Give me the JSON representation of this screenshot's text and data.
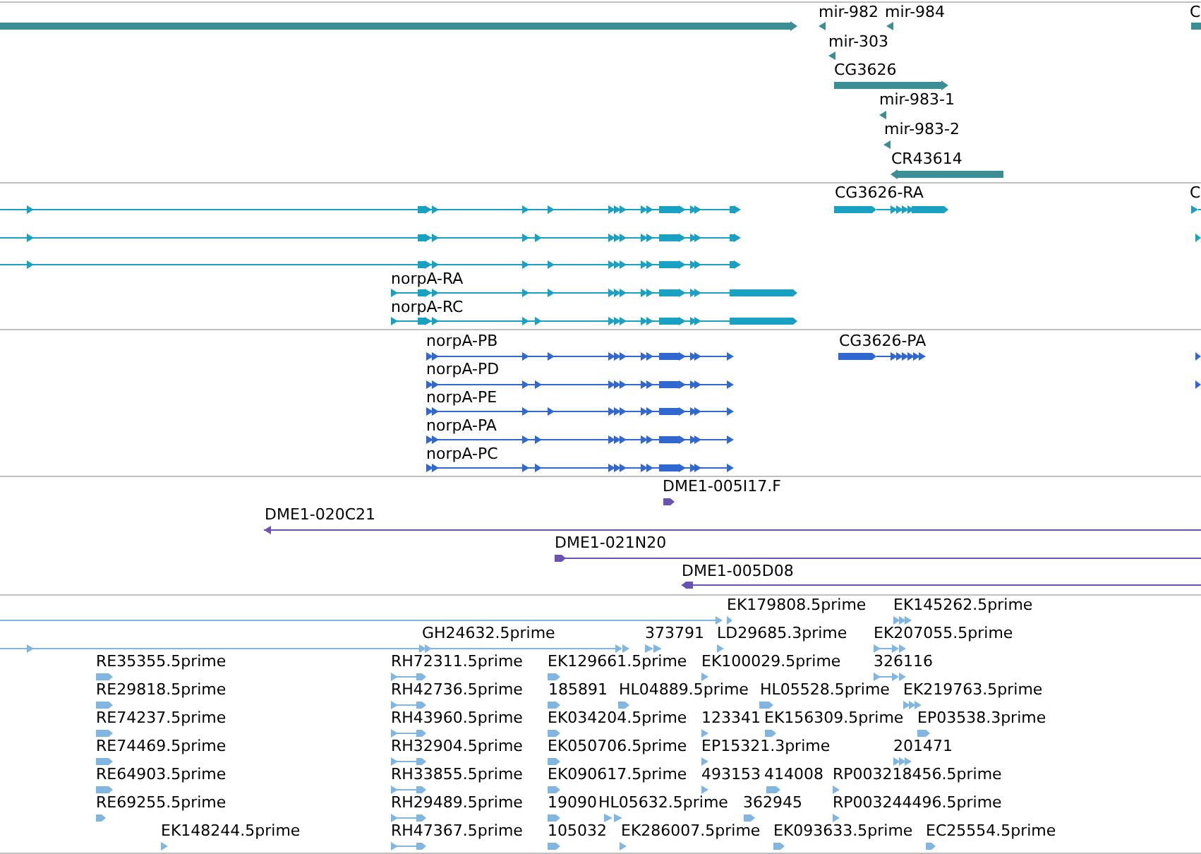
{
  "tracks": [
    {
      "color": "#3b8e93",
      "labels": [
        "mir-982",
        "mir-984",
        "C",
        "mir-303",
        "CG3626",
        "mir-983-1",
        "mir-983-2",
        "CR43614"
      ]
    },
    {
      "color": "#19a1c4",
      "labels": [
        "CG3626-RA",
        "C",
        "norpA-RA",
        "norpA-RC"
      ]
    },
    {
      "color": "#3068cf",
      "labels": [
        "norpA-PB",
        "CG3626-PA",
        "norpA-PD",
        "norpA-PE",
        "norpA-PA",
        "norpA-PC"
      ]
    },
    {
      "color": "#6a52b2",
      "labels": [
        "DME1-005I17.F",
        "DME1-020C21",
        "DME1-021N20",
        "DME1-005D08"
      ]
    },
    {
      "color": "#80b6e0",
      "labels": [
        "EK179808.5prime",
        "EK145262.5prime",
        "GH24632.5prime",
        "373791",
        "LD29685.3prime",
        "EK207055.5prime",
        "RE35355.5prime",
        "RH72311.5prime",
        "EK129661.5prime",
        "EK100029.5prime",
        "326116",
        "RE29818.5prime",
        "RH42736.5prime",
        "185891",
        "HL04889.5prime",
        "HL05528.5prime",
        "EK219763.5prime",
        "RE74237.5prime",
        "RH43960.5prime",
        "EK034204.5prime",
        "123341",
        "EK156309.5prime",
        "EP03538.3prime",
        "RE74469.5prime",
        "RH32904.5prime",
        "EK050706.5prime",
        "EP15321.3prime",
        "201471",
        "RE64903.5prime",
        "RH33855.5prime",
        "EK090617.5prime",
        "493153",
        "414008",
        "RP003218456.5prime",
        "RE69255.5prime",
        "RH29489.5prime",
        "19090",
        "HL05632.5prime",
        "362945",
        "RP003244496.5prime",
        "EK148244.5prime",
        "RH47367.5prime",
        "105032",
        "EK286007.5prime",
        "EK093633.5prime",
        "EC25554.5prime"
      ]
    }
  ]
}
